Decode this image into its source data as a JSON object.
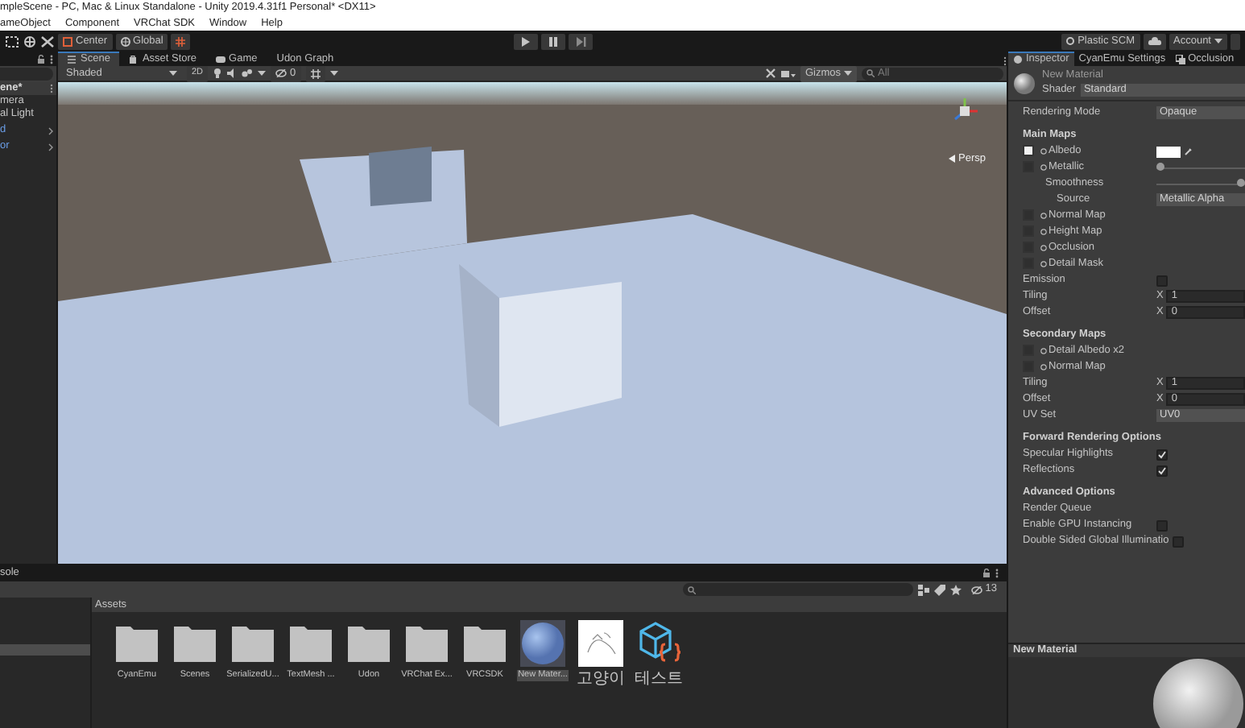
{
  "window": {
    "title": "mpleScene - PC, Mac & Linux Standalone - Unity 2019.4.31f1 Personal* <DX11>"
  },
  "menu": [
    "ameObject",
    "Component",
    "VRChat SDK",
    "Window",
    "Help"
  ],
  "toolbar": {
    "pivot": "Center",
    "space": "Global",
    "right_buttons": [
      {
        "label": "Plastic SCM",
        "kind": "button"
      },
      {
        "label": "Account",
        "kind": "dropdown"
      }
    ]
  },
  "hierarchy": {
    "items": [
      {
        "label": "ene*",
        "kind": "scene"
      },
      {
        "label": "mera",
        "kind": "object"
      },
      {
        "label": "al Light",
        "kind": "object"
      },
      {
        "label": "d",
        "kind": "prefab"
      },
      {
        "label": "or",
        "kind": "prefab"
      }
    ]
  },
  "scene": {
    "tabs": [
      {
        "label": "Scene",
        "selected": true
      },
      {
        "label": "Asset Store",
        "selected": false
      },
      {
        "label": "Game",
        "selected": false
      },
      {
        "label": "Udon Graph",
        "selected": false
      }
    ],
    "draw_mode": "Shaded",
    "mode_2d": "2D",
    "fx_count": "0",
    "gizmos": "Gizmos",
    "search": {
      "placeholder": "All"
    },
    "view": "Persp"
  },
  "inspector": {
    "tabs": [
      {
        "label": "Inspector",
        "selected": true
      },
      {
        "label": "CyanEmu Settings",
        "selected": false
      },
      {
        "label": "Occlusion",
        "selected": false
      }
    ],
    "material": "New Material",
    "shader_label": "Shader",
    "shader": "Standard",
    "properties": [
      {
        "kind": "dropdown",
        "label": "Rendering Mode",
        "value": "Opaque"
      },
      {
        "kind": "header",
        "label": "Main Maps"
      },
      {
        "kind": "texture",
        "label": "Albedo",
        "assigned": true,
        "color": "#ffffff"
      },
      {
        "kind": "texture",
        "label": "Metallic",
        "assigned": false,
        "level": 0
      },
      {
        "kind": "slider",
        "label": "Smoothness",
        "level": 1
      },
      {
        "kind": "dropdown",
        "label": "Source",
        "value": "Metallic Alpha",
        "indent": true
      },
      {
        "kind": "texture",
        "label": "Normal Map",
        "assigned": false
      },
      {
        "kind": "texture",
        "label": "Height Map",
        "assigned": false
      },
      {
        "kind": "texture",
        "label": "Occlusion",
        "assigned": false
      },
      {
        "kind": "texture",
        "label": "Detail Mask",
        "assigned": false
      },
      {
        "kind": "checkbox",
        "label": "Emission",
        "checked": false
      },
      {
        "kind": "vector",
        "label": "Tiling",
        "axis": "X",
        "value": "1"
      },
      {
        "kind": "vector",
        "label": "Offset",
        "axis": "X",
        "value": "0"
      },
      {
        "kind": "header",
        "label": "Secondary Maps"
      },
      {
        "kind": "texture",
        "label": "Detail Albedo x2",
        "assigned": false
      },
      {
        "kind": "texture",
        "label": "Normal Map",
        "assigned": false
      },
      {
        "kind": "vector",
        "label": "Tiling",
        "axis": "X",
        "value": "1"
      },
      {
        "kind": "vector",
        "label": "Offset",
        "axis": "X",
        "value": "0"
      },
      {
        "kind": "dropdown",
        "label": "UV Set",
        "value": "UV0"
      },
      {
        "kind": "header",
        "label": "Forward Rendering Options"
      },
      {
        "kind": "checkbox",
        "label": "Specular Highlights",
        "checked": true
      },
      {
        "kind": "checkbox",
        "label": "Reflections",
        "checked": true
      },
      {
        "kind": "header",
        "label": "Advanced Options"
      },
      {
        "kind": "label",
        "label": "Render Queue"
      },
      {
        "kind": "checkbox",
        "label": "Enable GPU Instancing",
        "checked": false
      },
      {
        "kind": "checkbox",
        "label": "Double Sided Global Illuminatio",
        "checked": false
      }
    ],
    "preview_title": "New Material"
  },
  "project": {
    "tab": "sole",
    "count": "13",
    "folder_title": "Assets",
    "assets": [
      {
        "label": "CyanEmu",
        "kind": "folder",
        "selected": false
      },
      {
        "label": "Scenes",
        "kind": "folder",
        "selected": false
      },
      {
        "label": "SerializedU...",
        "kind": "folder",
        "selected": false
      },
      {
        "label": "TextMesh ...",
        "kind": "folder",
        "selected": false
      },
      {
        "label": "Udon",
        "kind": "folder",
        "selected": false
      },
      {
        "label": "VRChat Ex...",
        "kind": "folder",
        "selected": false
      },
      {
        "label": "VRCSDK",
        "kind": "folder",
        "selected": false
      },
      {
        "label": "New Mater...",
        "kind": "material",
        "selected": true
      },
      {
        "label": "고양이",
        "kind": "image",
        "selected": false
      },
      {
        "label": "테스트",
        "kind": "script",
        "selected": false
      }
    ]
  }
}
